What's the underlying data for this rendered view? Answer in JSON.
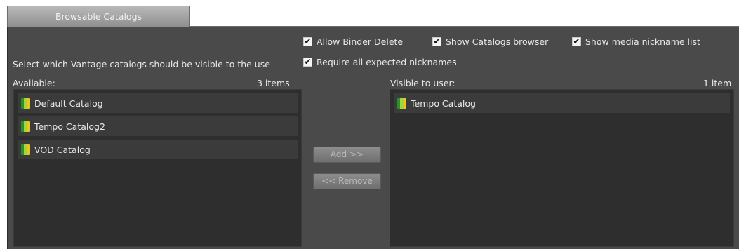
{
  "tab": {
    "label": "Browsable Catalogs"
  },
  "options": {
    "allow_binder_delete": {
      "label": "Allow Binder Delete",
      "checked": true
    },
    "show_catalogs_browser": {
      "label": "Show Catalogs browser",
      "checked": true
    },
    "show_media_nickname_list": {
      "label": "Show media nickname list",
      "checked": true
    },
    "require_all_expected_nicknames": {
      "label": "Require all expected nicknames",
      "checked": true
    }
  },
  "instructions": "Select which Vantage catalogs should be visible to the user",
  "available": {
    "label": "Available:",
    "count": "3 items",
    "items": [
      {
        "label": "Default Catalog",
        "icon": "catalog-icon"
      },
      {
        "label": "Tempo Catalog2",
        "icon": "catalog-icon"
      },
      {
        "label": "VOD Catalog",
        "icon": "catalog-icon"
      }
    ]
  },
  "visible": {
    "label": "Visible to user:",
    "count": "1 item",
    "items": [
      {
        "label": "Tempo Catalog",
        "icon": "catalog-icon"
      }
    ]
  },
  "buttons": {
    "add": "Add >>",
    "remove": "<< Remove"
  },
  "check_mark": "✔",
  "colors": {
    "panel": "#4a4a4a",
    "list": "#2e2e2e",
    "item": "#3b3b3b"
  }
}
